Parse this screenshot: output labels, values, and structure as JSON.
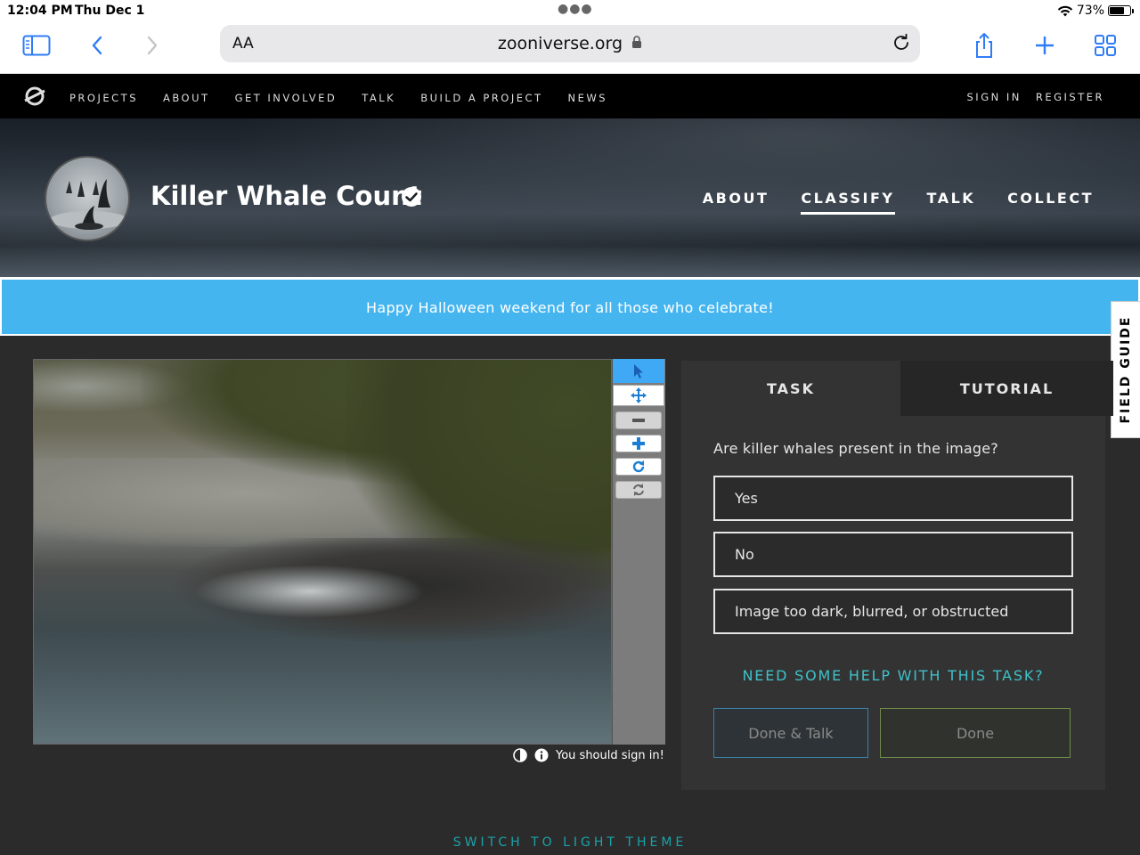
{
  "status_bar": {
    "time": "12:04 PM",
    "date": "Thu Dec 1",
    "battery": "73%",
    "battery_level": 0.73
  },
  "browser": {
    "text_size_label": "AA",
    "url": "zooniverse.org"
  },
  "top_nav": {
    "links": [
      "PROJECTS",
      "ABOUT",
      "GET INVOLVED",
      "TALK",
      "BUILD A PROJECT",
      "NEWS"
    ],
    "sign_in": "SIGN IN",
    "register": "REGISTER"
  },
  "project": {
    "title": "Killer Whale Count",
    "nav": [
      "ABOUT",
      "CLASSIFY",
      "TALK",
      "COLLECT"
    ],
    "active_nav": "CLASSIFY"
  },
  "banner": {
    "text": "Happy Halloween weekend for all those who celebrate!"
  },
  "field_guide": {
    "label": "FIELD GUIDE"
  },
  "viewer": {
    "tools": [
      "pointer-icon",
      "move-icon",
      "zoom-out-icon",
      "zoom-in-icon",
      "rotate-icon",
      "reset-icon"
    ],
    "sign_in_notice": "You should sign in!"
  },
  "task": {
    "tabs": [
      "TASK",
      "TUTORIAL"
    ],
    "question": "Are killer whales present in the image?",
    "answers": [
      "Yes",
      "No",
      "Image too dark, blurred, or obstructed"
    ],
    "help_link": "NEED SOME HELP WITH THIS TASK?",
    "done_talk_label": "Done & Talk",
    "done_label": "Done"
  },
  "footer": {
    "switch_theme": "SWITCH TO LIGHT THEME"
  },
  "colors": {
    "banner": "#45b5f0",
    "accent_teal": "#3fc1c9",
    "tool_active": "#3fa9f5"
  }
}
